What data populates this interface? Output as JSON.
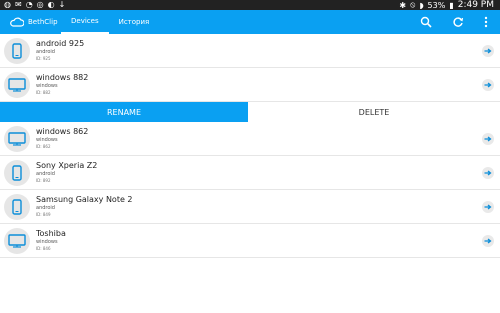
{
  "status_bar": {
    "battery": "53%",
    "time": "2:49 PM"
  },
  "app_bar": {
    "brand": "BethClip",
    "tabs": [
      {
        "label": "Devices"
      },
      {
        "label": "История"
      }
    ]
  },
  "devices": [
    {
      "name": "android 925",
      "type": "android",
      "id": "ID: 925",
      "icon": "phone-icon"
    },
    {
      "name": "windows 882",
      "type": "windows",
      "id": "ID: 882",
      "icon": "monitor-icon"
    },
    {
      "name": "windows 862",
      "type": "windows",
      "id": "ID: 862",
      "icon": "monitor-icon"
    },
    {
      "name": "Sony Xperia Z2",
      "type": "android",
      "id": "ID: 892",
      "icon": "phone-icon"
    },
    {
      "name": "Samsung Galaxy Note 2",
      "type": "android",
      "id": "ID: 849",
      "icon": "phone-icon"
    },
    {
      "name": "Toshiba",
      "type": "windows",
      "id": "ID: 846",
      "icon": "monitor-icon"
    }
  ],
  "actions": {
    "rename": "RENAME",
    "delete": "DELETE"
  },
  "colors": {
    "accent": "#0aa0f2",
    "icon_blue": "#0c8ed9"
  }
}
